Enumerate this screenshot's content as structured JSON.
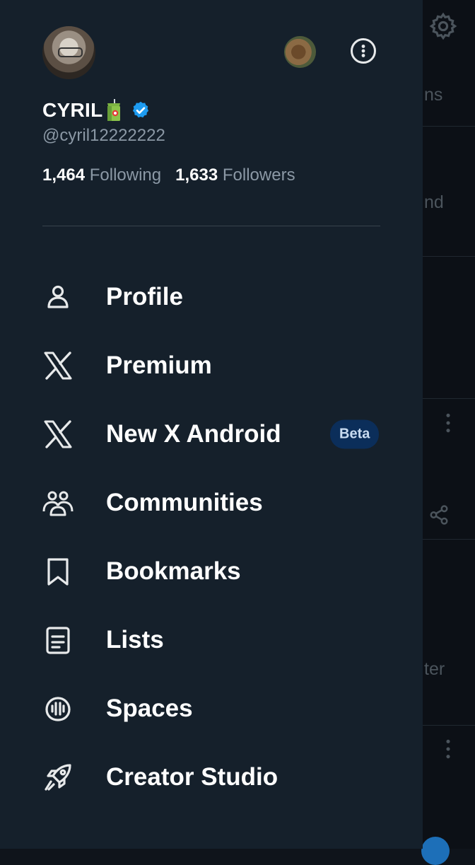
{
  "profile": {
    "display_name": "CYRIL",
    "handle": "@cyril12222222",
    "following_count": "1,464",
    "following_label": "Following",
    "followers_count": "1,633",
    "followers_label": "Followers",
    "verified": true
  },
  "menu": {
    "items": [
      {
        "label": "Profile",
        "icon": "person-icon"
      },
      {
        "label": "Premium",
        "icon": "x-logo-icon"
      },
      {
        "label": "New X Android",
        "icon": "x-logo-icon",
        "badge": "Beta"
      },
      {
        "label": "Communities",
        "icon": "people-icon"
      },
      {
        "label": "Bookmarks",
        "icon": "bookmark-icon"
      },
      {
        "label": "Lists",
        "icon": "list-icon"
      },
      {
        "label": "Spaces",
        "icon": "spaces-icon"
      },
      {
        "label": "Creator Studio",
        "icon": "rocket-icon"
      }
    ]
  },
  "background": {
    "fragments": [
      "ns",
      "nd",
      "ter"
    ]
  },
  "colors": {
    "drawer_bg": "#15202b",
    "verified_blue": "#1d9bf0",
    "beta_bg": "#0b2e5a"
  }
}
